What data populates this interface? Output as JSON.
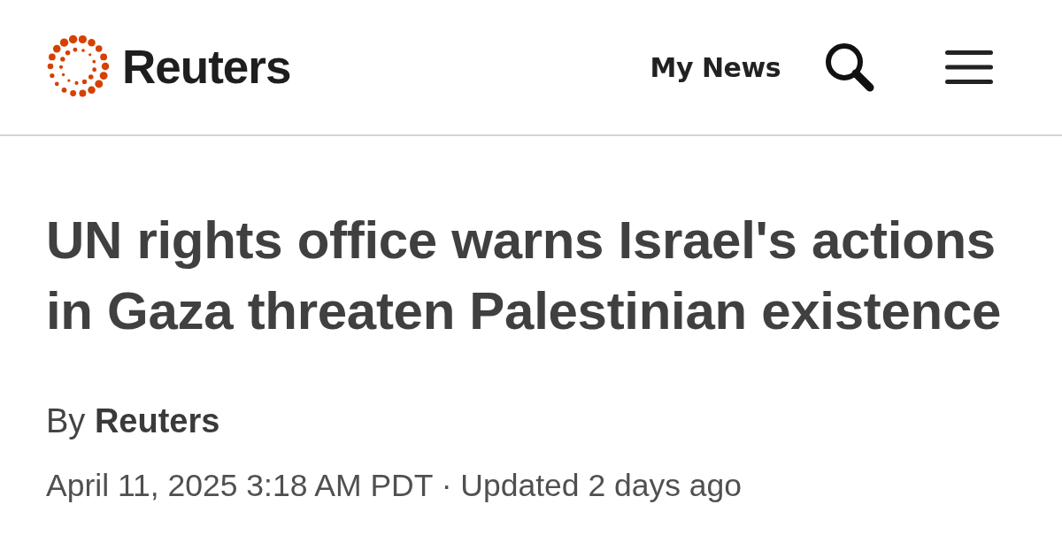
{
  "header": {
    "logo_text": "Reuters",
    "my_news": "My News"
  },
  "article": {
    "headline": "UN rights office warns Israel's actions in Gaza threaten Palestinian existence",
    "byline": "By **Reuters**",
    "dateline": "April 11, 2025 3:18 AM PDT · Updated 2 days ago"
  }
}
